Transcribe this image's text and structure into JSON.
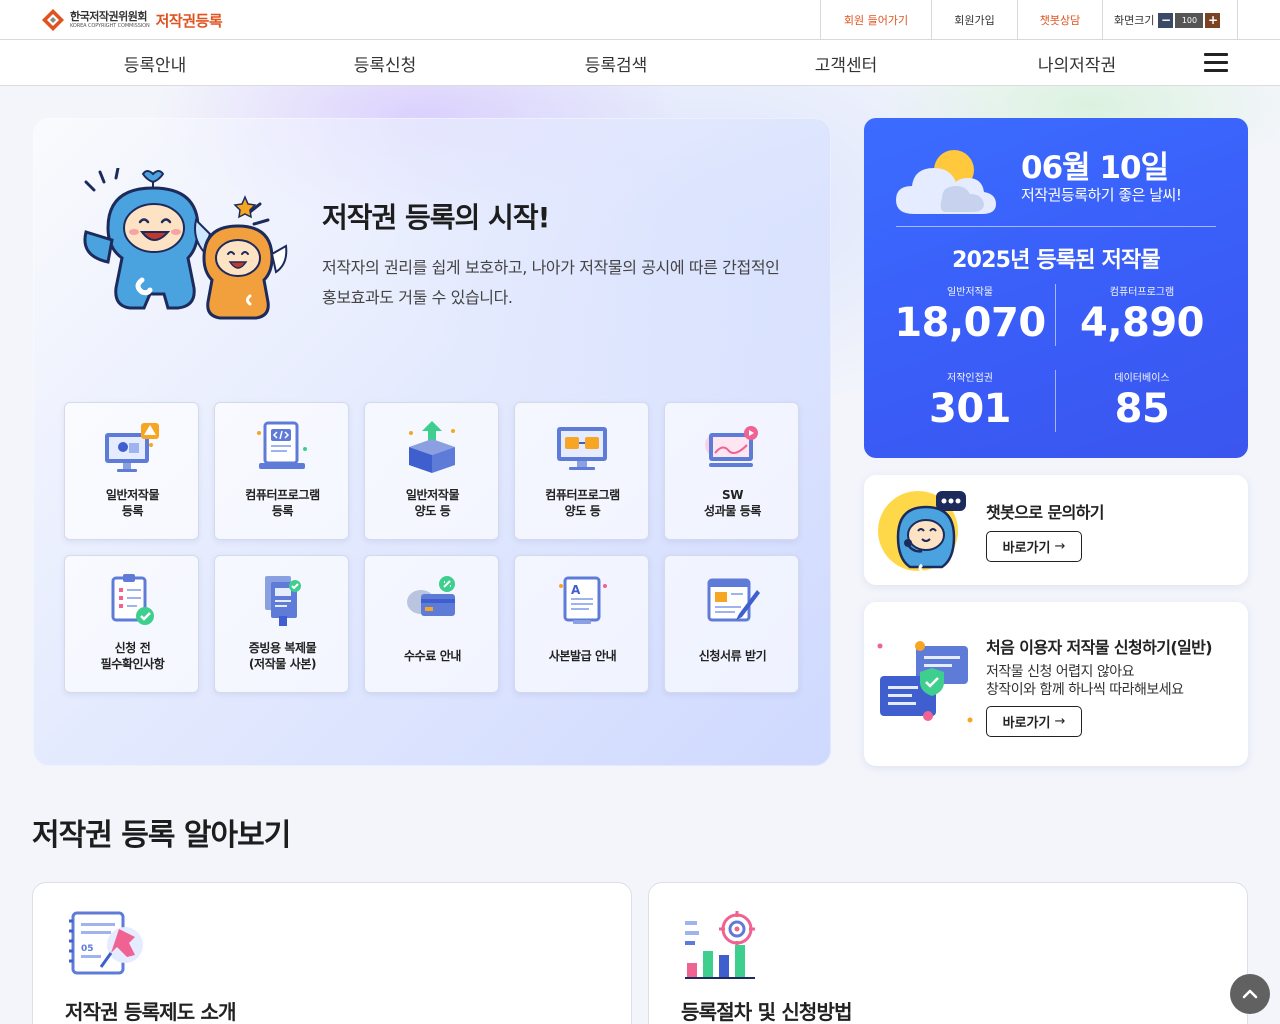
{
  "header": {
    "org_name": "한국저작권위원회",
    "org_name_en": "KOREA COPYRIGHT COMMISSION",
    "service_name": "저작권등록",
    "util": {
      "login": "회원 들어가기",
      "join": "회원가입",
      "chatbot": "챗봇상담",
      "zoom_label": "화면크기",
      "zoom_value": "100",
      "zoom_minus": "−",
      "zoom_plus": "+"
    }
  },
  "nav": {
    "items": [
      "등록안내",
      "등록신청",
      "등록검색",
      "고객센터",
      "나의저작권"
    ]
  },
  "hero": {
    "title": "저작권 등록의 시작!",
    "description": "저작자의 권리를 쉽게 보호하고, 나아가 저작물의 공시에 따른 간접적인 홍보효과도 거둘 수 있습니다.",
    "services": [
      {
        "line1": "일반저작물",
        "line2": "등록",
        "icon": "monitor-brush-icon"
      },
      {
        "line1": "컴퓨터프로그램",
        "line2": "등록",
        "icon": "code-document-icon"
      },
      {
        "line1": "일반저작물",
        "line2": "양도 등",
        "icon": "box-upload-icon"
      },
      {
        "line1": "컴퓨터프로그램",
        "line2": "양도 등",
        "icon": "monitor-folders-icon"
      },
      {
        "line1": "SW",
        "line2": "성과물 등록",
        "icon": "monitor-play-icon"
      },
      {
        "line1": "신청 전",
        "line2": "필수확인사항",
        "icon": "clipboard-check-icon"
      },
      {
        "line1": "증빙용 복제물",
        "line2": "(저작물 사본)",
        "icon": "document-copy-icon"
      },
      {
        "line1": "수수료 안내",
        "line2": "",
        "icon": "money-card-icon"
      },
      {
        "line1": "사본발급 안내",
        "line2": "",
        "icon": "document-a-icon"
      },
      {
        "line1": "신청서류 받기",
        "line2": "",
        "icon": "form-pencil-icon"
      }
    ]
  },
  "stats": {
    "date": "06월 10일",
    "weather_text": "저작권등록하기 좋은 날씨!",
    "title": "2025년 등록된 저작물",
    "items": [
      {
        "label": "일반저작물",
        "value": "18,070"
      },
      {
        "label": "컴퓨터프로그램",
        "value": "4,890"
      },
      {
        "label": "저작인접권",
        "value": "301"
      },
      {
        "label": "데이터베이스",
        "value": "85"
      }
    ]
  },
  "chatbot_card": {
    "title": "챗봇으로 문의하기",
    "button": "바로가기"
  },
  "firstuser_card": {
    "title": "처음 이용자 저작물 신청하기(일반)",
    "desc1": "저작물 신청 어렵지 않아요",
    "desc2": "창작이와 함께 하나씩 따라해보세요",
    "button": "바로가기"
  },
  "section": {
    "title": "저작권 등록 알아보기",
    "cards": [
      {
        "title": "저작권 등록제도 소개"
      },
      {
        "title": "등록절차 및 신청방법"
      }
    ]
  },
  "colors": {
    "accent": "#e0531f",
    "stats_blue": "#3a5cf7"
  }
}
